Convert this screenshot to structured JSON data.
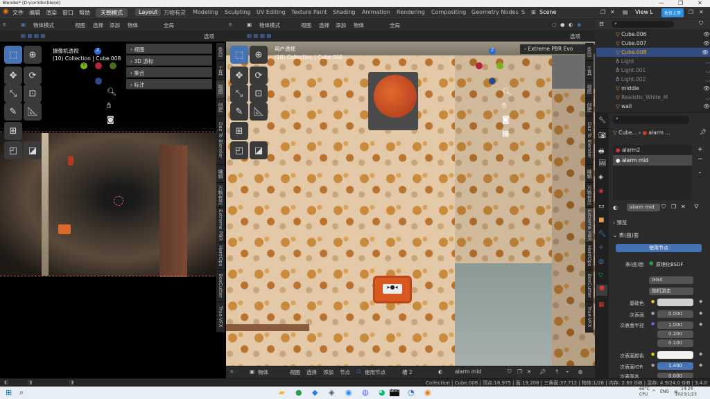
{
  "window": {
    "title": "Blender* [D:\\corridor.blend]",
    "min": "—",
    "max": "❐",
    "close": "✕"
  },
  "menu": [
    "文件",
    "编辑",
    "渲染",
    "窗口",
    "帮助"
  ],
  "workspace_tabs": {
    "active_pre": "天朝模式",
    "items": [
      "Layout",
      "万物有灵",
      "Modeling",
      "Sculpting",
      "UV Editing",
      "Texture Paint",
      "Shading",
      "Animation",
      "Rendering",
      "Compositing",
      "Geometry Nodes",
      "S"
    ]
  },
  "scene": "Scene",
  "view_layer": "View L",
  "ad_badge": "佐拉上市",
  "left_vp": {
    "mode": "物体模式",
    "menus": [
      "视图",
      "选择",
      "添加",
      "物体"
    ],
    "transform": "全局",
    "options": "选项",
    "title": "摄像机透视",
    "subtitle": "(10) Collection | Cube.008",
    "panels": [
      "视图",
      "3D 游标",
      "集合",
      "标注"
    ],
    "side_tabs": [
      "条目",
      "工具",
      "视图",
      "创建",
      "Daz To Blender",
      "编辑",
      "万物有灵",
      "Extreme PBR",
      "HardOps",
      "BoxCutter",
      "True-VFX"
    ]
  },
  "right_vp": {
    "mode": "物体模式",
    "menus": [
      "视图",
      "选择",
      "添加",
      "物体"
    ],
    "transform": "全局",
    "options": "选项",
    "title": "用户透视",
    "subtitle": "(10) Collection | Cube.008",
    "pbr_panel": "Extreme PBR Evo",
    "side_tabs": [
      "条目",
      "工具",
      "视图",
      "创建",
      "Daz To Blender",
      "编辑",
      "万物有灵",
      "Extreme PBR",
      "HardOps",
      "BoxCutter",
      "True-VFX"
    ]
  },
  "outliner": [
    {
      "name": "Cube.006",
      "sel": false,
      "dim": false
    },
    {
      "name": "Cube.007",
      "sel": false,
      "dim": false
    },
    {
      "name": "Cube.008",
      "sel": true,
      "dim": false
    },
    {
      "name": "Light",
      "sel": false,
      "dim": true
    },
    {
      "name": "Light.001",
      "sel": false,
      "dim": true
    },
    {
      "name": "Light.002",
      "sel": false,
      "dim": true
    },
    {
      "name": "middle",
      "sel": false,
      "dim": false
    },
    {
      "name": "Realistic_White_M",
      "sel": false,
      "dim": true
    },
    {
      "name": "wall",
      "sel": false,
      "dim": false
    }
  ],
  "properties": {
    "breadcrumb_obj": "Cube...",
    "breadcrumb_mat": "alarm ...",
    "slots": [
      "alarm2",
      "alarm mid"
    ],
    "material_name": "alarm mid",
    "preview": "预览",
    "surface_section": "表(曲)面",
    "use_nodes": "使用节点",
    "surface_label": "表(曲)面",
    "surface_value": "原理化BSDF",
    "distribution": "GGX",
    "subsurface_method": "随机游走",
    "base_color_label": "基础色",
    "subsurface_label": "次表面",
    "subsurface_value": "0.000",
    "radius_label": "次表面半径",
    "radius": [
      "1.000",
      "0.200",
      "0.100"
    ],
    "sss_color_label": "次表面颜色",
    "ior_label": "次表面IOR",
    "ior_value": "1.400",
    "aniso_label": "次表面各",
    "aniso_value": "0.000"
  },
  "bottom_bar": {
    "object": "物体",
    "menus": [
      "视图",
      "选择",
      "添加",
      "节点"
    ],
    "use_nodes": "使用节点",
    "slot": "槽 2",
    "material": "alarm mid"
  },
  "status": "Collection | Cube.008 | 顶点:18,975 | 面:19,208 | 三角面:37,712 | 物体:1/26 | 内存: 2.69 GiB | 显存: 4.9/24.0 GiB | 3.4.0",
  "taskbar": {
    "temp": "66°C",
    "cpu": "CPU",
    "lang": "ENG",
    "time": "14:24",
    "date": "2023/1/23"
  }
}
